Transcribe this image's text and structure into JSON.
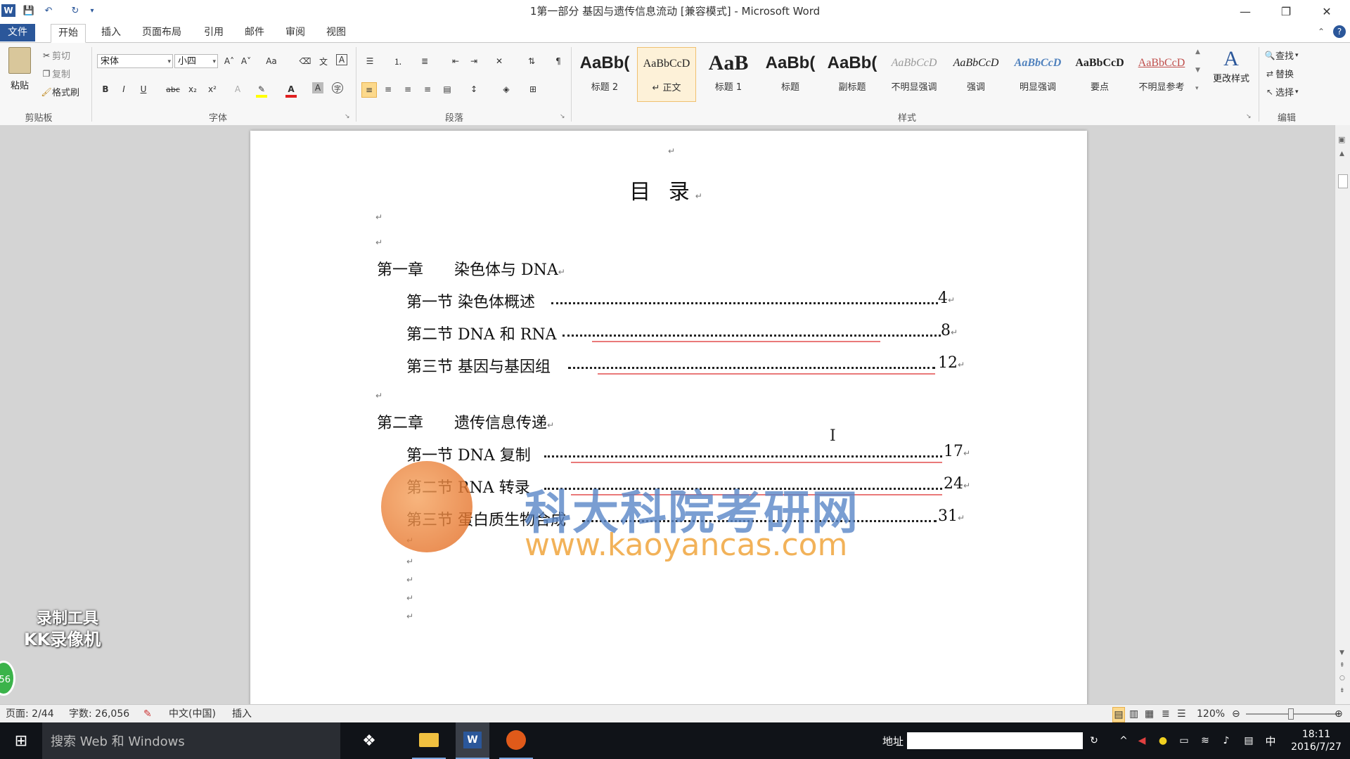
{
  "window": {
    "title": "1第一部分 基因与遗传信息流动 [兼容模式] - Microsoft Word",
    "app_icon": "W",
    "controls": {
      "minimize": "—",
      "restore": "❐",
      "close": "✕"
    }
  },
  "tabs": [
    {
      "label": "文件"
    },
    {
      "label": "开始"
    },
    {
      "label": "插入"
    },
    {
      "label": "页面布局"
    },
    {
      "label": "引用"
    },
    {
      "label": "邮件"
    },
    {
      "label": "审阅"
    },
    {
      "label": "视图"
    }
  ],
  "ribbon": {
    "clipboard": {
      "paste": "粘贴",
      "cut": "剪切",
      "copy": "复制",
      "format_painter": "格式刷",
      "group_label": "剪贴板"
    },
    "font": {
      "font_name": "宋体",
      "font_size": "小四",
      "group_label": "字体",
      "bold": "B",
      "italic": "I",
      "underline": "U",
      "strike": "abc",
      "subscript": "x₂",
      "superscript": "x²",
      "grow": "A˄",
      "shrink": "A˅",
      "change_case": "Aa",
      "highlight_color": "#ffff00",
      "font_color": "#e02020"
    },
    "paragraph": {
      "group_label": "段落"
    },
    "styles": {
      "group_label": "样式",
      "items": [
        {
          "preview": "AaBb(",
          "name": "标题 2"
        },
        {
          "preview": "AaBbCcD",
          "name": "↵ 正文"
        },
        {
          "preview": "AaB",
          "name": "标题 1"
        },
        {
          "preview": "AaBb(",
          "name": "标题"
        },
        {
          "preview": "AaBb(",
          "name": "副标题"
        },
        {
          "preview": "AaBbCcD",
          "name": "不明显强调"
        },
        {
          "preview": "AaBbCcD",
          "name": "强调"
        },
        {
          "preview": "AaBbCcD",
          "name": "明显强调"
        },
        {
          "preview": "AaBbCcD",
          "name": "要点"
        },
        {
          "preview": "AaBbCcD",
          "name": "不明显参考"
        }
      ],
      "change_styles": "更改样式"
    },
    "editing": {
      "group_label": "编辑",
      "find": "查找",
      "replace": "替换",
      "select": "选择"
    }
  },
  "document": {
    "title": "目 录",
    "chapters": [
      {
        "title": "第一章　　染色体与 DNA",
        "sections": [
          {
            "title": "第一节  染色体概述",
            "page": "4"
          },
          {
            "title": "第二节  DNA 和 RNA",
            "page": "8"
          },
          {
            "title": "第三节  基因与基因组",
            "page": "12"
          }
        ]
      },
      {
        "title": "第二章　　遗传信息传递",
        "sections": [
          {
            "title": "第一节  DNA 复制",
            "page": "17"
          },
          {
            "title": "第二节  RNA 转录",
            "page": "24"
          },
          {
            "title": "第三节  蛋白质生物合成",
            "page": "31"
          }
        ]
      }
    ],
    "paragraph_mark": "↵"
  },
  "watermark": {
    "brand": "科大科院考研网",
    "url": "www.kaoyancas.com",
    "recorder_line1": "录制工具",
    "recorder_line2": "KK录像机",
    "badge": "56"
  },
  "status_bar": {
    "page": "页面: 2/44",
    "words": "字数: 26,056",
    "language": "中文(中国)",
    "mode": "插入",
    "zoom": "120%"
  },
  "taskbar": {
    "search_placeholder": "搜索 Web 和 Windows",
    "address_label": "地址",
    "ime": "中",
    "time": "18:11",
    "date": "2016/7/27"
  }
}
